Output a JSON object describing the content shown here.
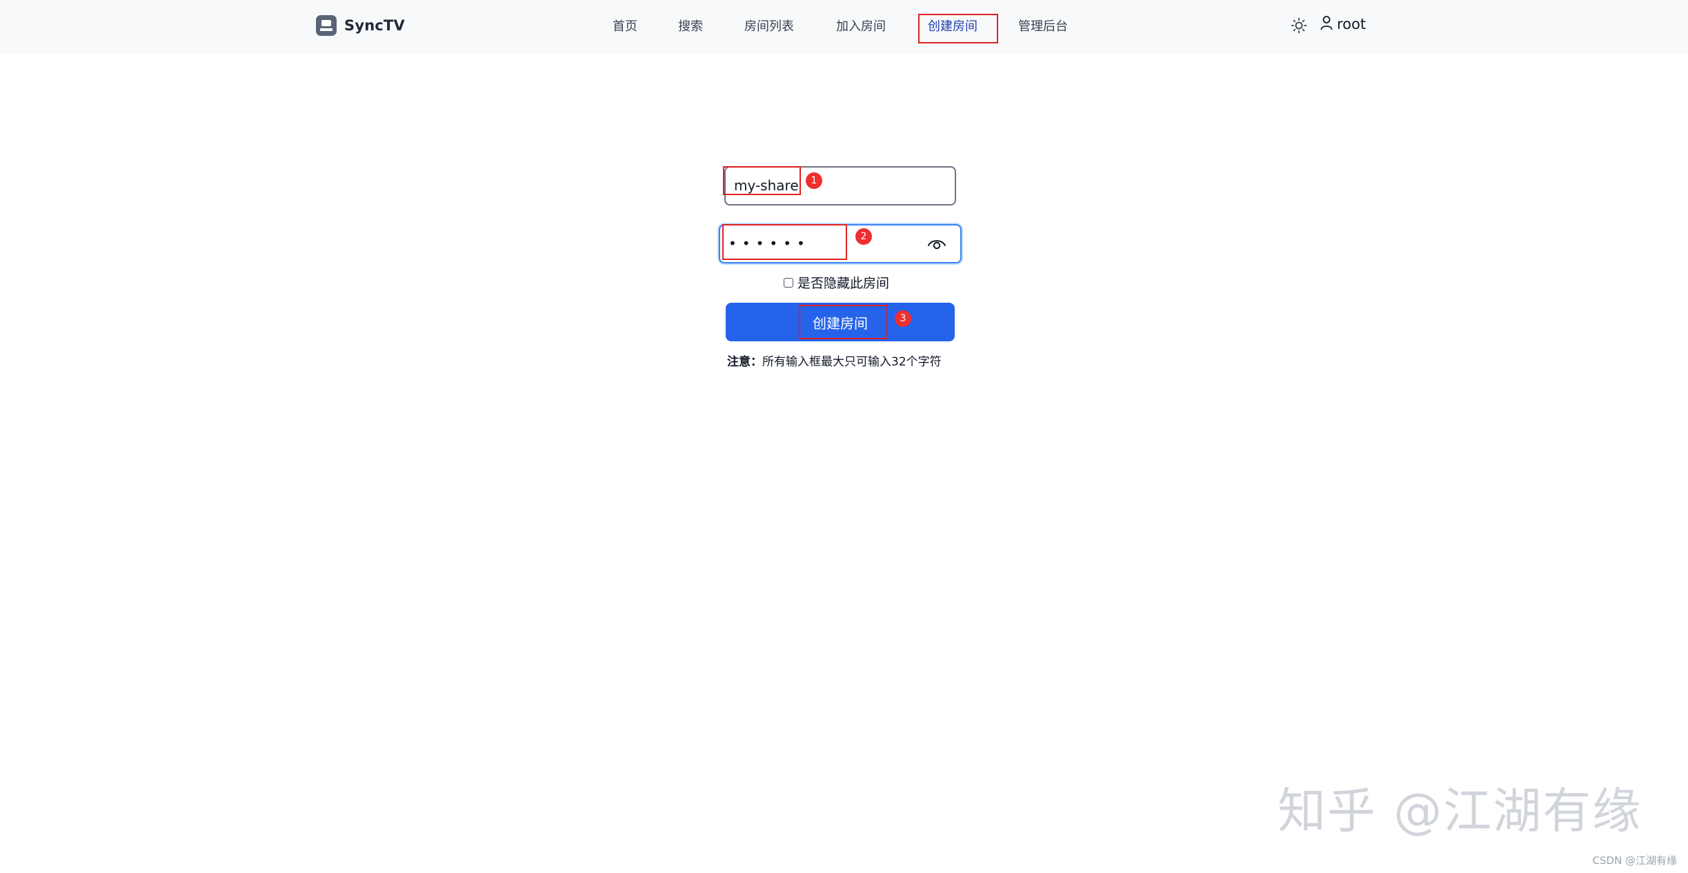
{
  "brand": {
    "name": "SyncTV",
    "logo_icon": "tv-icon"
  },
  "nav": {
    "items": [
      {
        "label": "首页"
      },
      {
        "label": "搜索"
      },
      {
        "label": "房间列表"
      },
      {
        "label": "加入房间"
      },
      {
        "label": "创建房间",
        "active": true
      },
      {
        "label": "管理后台"
      }
    ]
  },
  "header": {
    "theme_icon": "sun-icon",
    "user_icon": "user-icon",
    "user_name": "root"
  },
  "form": {
    "room_name_value": "my-share",
    "password_value": "••••••",
    "password_toggle_icon": "eye-icon",
    "hide_room_label": "是否隐藏此房间",
    "hide_room_checked": false,
    "submit_label": "创建房间",
    "note_label": "注意：",
    "note_text": "所有输入框最大只可输入32个字符"
  },
  "annotations": {
    "badge_1": "1",
    "badge_2": "2",
    "badge_3": "3",
    "color": "#e02020"
  },
  "watermark": {
    "main": "知乎 @江湖有缘",
    "small": "CSDN @江湖有缘"
  },
  "colors": {
    "primary": "#2563eb",
    "nav_active": "#1e40af",
    "annotation_red": "#e02020"
  }
}
